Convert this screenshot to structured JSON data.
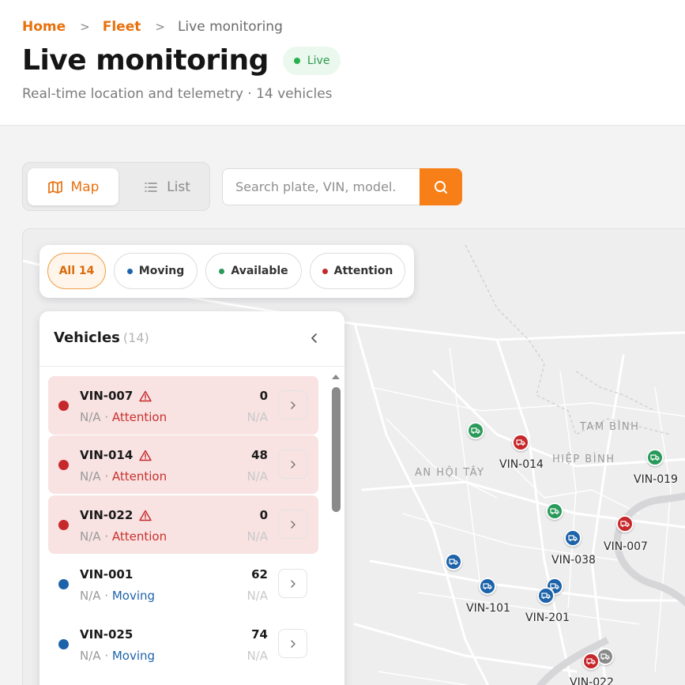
{
  "breadcrumb": {
    "home": "Home",
    "fleet": "Fleet",
    "current": "Live monitoring"
  },
  "page": {
    "title": "Live monitoring",
    "live_badge": "Live",
    "subtitle": "Real-time location and telemetry · 14 vehicles"
  },
  "view_toggle": {
    "map_label": "Map",
    "list_label": "List",
    "selected": "Map"
  },
  "search": {
    "placeholder": "Search plate, VIN, model."
  },
  "filters": {
    "all": "All 14",
    "moving": "Moving",
    "available": "Available",
    "attention": "Attention"
  },
  "panel": {
    "title": "Vehicles",
    "count": "(14)",
    "vehicles": [
      {
        "plate": "VIN-007",
        "speed": "0",
        "location": "N/A",
        "status": "Attention",
        "sub": "N/A"
      },
      {
        "plate": "VIN-014",
        "speed": "48",
        "location": "N/A",
        "status": "Attention",
        "sub": "N/A"
      },
      {
        "plate": "VIN-022",
        "speed": "0",
        "location": "N/A",
        "status": "Attention",
        "sub": "N/A"
      },
      {
        "plate": "VIN-001",
        "speed": "62",
        "location": "N/A",
        "status": "Moving",
        "sub": "N/A"
      },
      {
        "plate": "VIN-025",
        "speed": "74",
        "location": "N/A",
        "status": "Moving",
        "sub": "N/A"
      }
    ]
  },
  "map": {
    "districts": [
      "TAM BÌNH",
      "HIỆP BÌNH",
      "AN HỘI TÂY"
    ],
    "labels": [
      "VIN-014",
      "VIN-019",
      "VIN-007",
      "VIN-038",
      "VIN-101",
      "VIN-201",
      "VIN-022"
    ]
  },
  "colors": {
    "accent": "#f77f17",
    "attention": "#c6282b",
    "moving": "#1d63a9",
    "available": "#2a9a5a",
    "live": "#28b14c"
  }
}
